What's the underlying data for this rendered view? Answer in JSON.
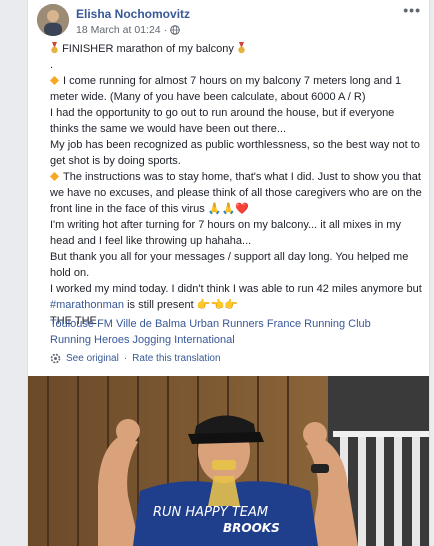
{
  "post": {
    "author": "Elisha Nochomovitz",
    "timestamp": "18 March at 01:24",
    "separator": "·",
    "more_label": "•••",
    "body": {
      "line_title": "FINISHER marathon of my balcony",
      "line_dot": ".",
      "p1": "I come running for almost 7 hours on my balcony 7 meters long and 1 meter wide. (Many of you have been calculate, about 6000 A / R)",
      "p2": "I had the opportunity to go out to run around the house, but if everyone thinks the same we would have been out there...",
      "p3": "My job has been recognized as public worthlessness, so the best way not to get shot is by doing sports.",
      "p4": "The instructions was to stay home, that's what I did. Just to show you that we have no excuses, and please think of all those caregivers who are on the front line in the face of this virus 🙏🙏❤️",
      "p5": "I'm writing hot after turning for 7 hours on my balcony... it all mixes in my head and I feel like throwing up hahaha...",
      "p6": "But thank you all for your messages / support all day long. You helped me hold on.",
      "p7_start": "I worked my mind today. I didn't think I was able to run 42 miles anymore but",
      "p7_hashtag": "#marathonman",
      "p7_end": "is still present 👉👈👉",
      "p8": "THE THE"
    },
    "tags_line1": "Toulouse FM Ville de Balma Urban Runners France Running Club",
    "tags_line2": "Running Heroes Jogging International",
    "see_original": "See original",
    "rate_translation": "Rate this translation",
    "photo": {
      "shirt_line1": "RUN HAPPY TEAM",
      "shirt_line2": "BROOKS"
    }
  },
  "colors": {
    "link": "#385898",
    "text": "#1d2129",
    "meta": "#616770",
    "diamond": "#f5a623"
  }
}
